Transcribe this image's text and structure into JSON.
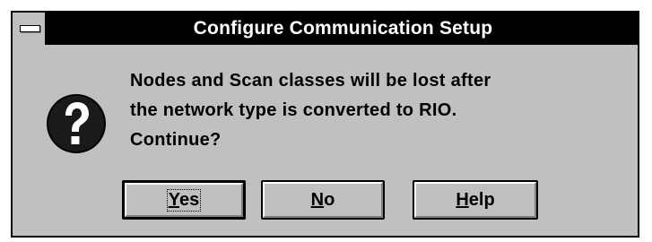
{
  "window": {
    "title": "Configure Communication Setup"
  },
  "message": {
    "lines": [
      "Nodes and Scan classes will be lost after",
      "the network type is converted to RIO.",
      "Continue?"
    ],
    "icon": "question-icon"
  },
  "buttons": {
    "yes": {
      "mnemonic": "Y",
      "rest": "es"
    },
    "no": {
      "mnemonic": "N",
      "rest": "o"
    },
    "help": {
      "mnemonic": "H",
      "rest": "elp"
    }
  },
  "colors": {
    "face": "#c0c0c0",
    "titlebar": "#000000",
    "title_text": "#ffffff",
    "icon_bg": "#000000",
    "icon_glyph": "#ffffff"
  }
}
